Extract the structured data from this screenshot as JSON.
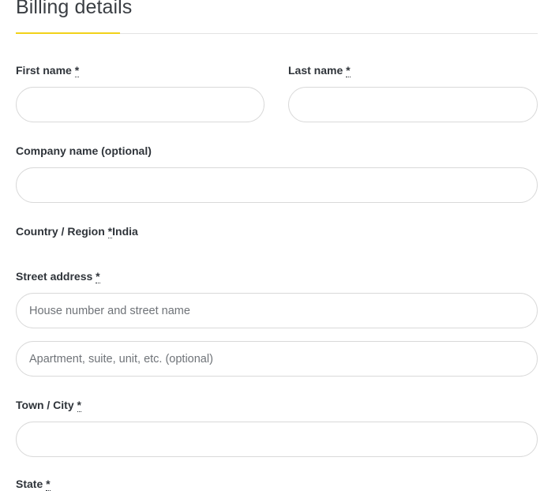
{
  "section": {
    "title": "Billing details"
  },
  "fields": {
    "first_name": {
      "label": "First name",
      "required_mark": "*",
      "value": "",
      "placeholder": ""
    },
    "last_name": {
      "label": "Last name",
      "required_mark": "*",
      "value": "",
      "placeholder": ""
    },
    "company": {
      "label": "Company name (optional)",
      "value": "",
      "placeholder": ""
    },
    "country": {
      "label": "Country / Region",
      "required_mark": "*",
      "value": "India"
    },
    "street": {
      "label": "Street address",
      "required_mark": "*",
      "line1_placeholder": "House number and street name",
      "line2_placeholder": "Apartment, suite, unit, etc. (optional)"
    },
    "city": {
      "label": "Town / City",
      "required_mark": "*",
      "value": "",
      "placeholder": ""
    },
    "state": {
      "label": "State",
      "required_mark": "*"
    }
  },
  "colors": {
    "accent": "#f2d21a",
    "border": "#d9d9d9",
    "label": "#2f343a"
  }
}
